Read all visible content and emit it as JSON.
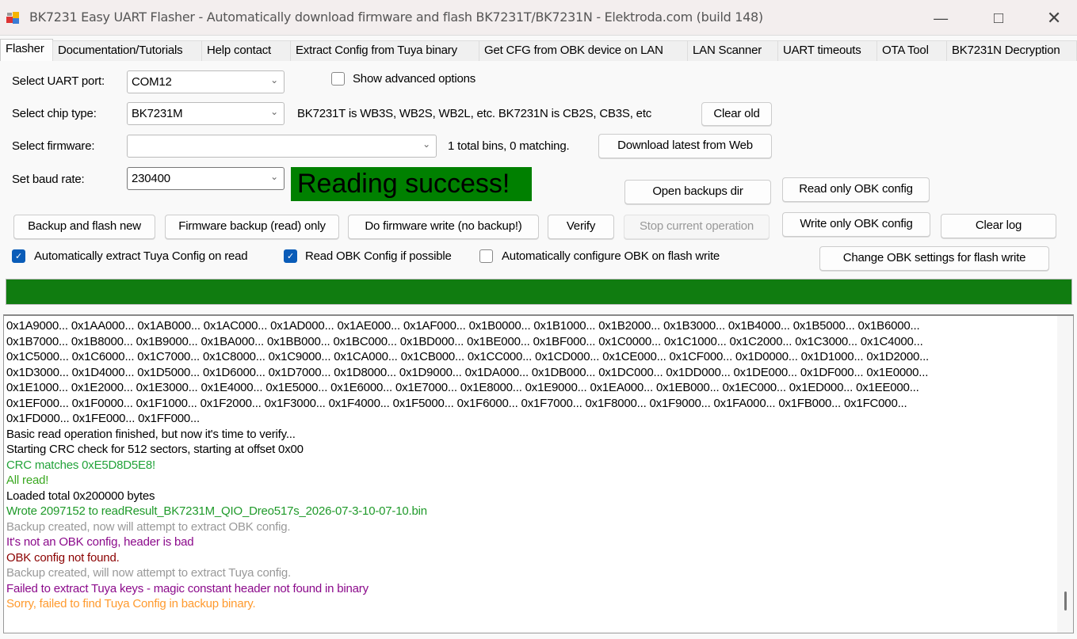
{
  "window": {
    "title": "BK7231 Easy UART Flasher - Automatically download firmware and flash BK7231T/BK7231N  - Elektroda.com (build 148)"
  },
  "tabs": [
    "Flasher",
    "Documentation/Tutorials",
    "Help contact",
    "Extract Config from Tuya binary",
    "Get CFG from OBK device on LAN",
    "LAN Scanner",
    "UART timeouts",
    "OTA Tool",
    "BK7231N Decryption"
  ],
  "form": {
    "uart_label": "Select UART port:",
    "uart_value": "COM12",
    "show_advanced": "Show advanced options",
    "chip_label": "Select chip type:",
    "chip_value": "BK7231M",
    "chip_hint": "BK7231T is WB3S, WB2S, WB2L, etc. BK7231N is CB2S, CB3S, etc",
    "clear_old": "Clear old",
    "firmware_label": "Select firmware:",
    "firmware_value": "",
    "bins_info": "1 total bins, 0 matching.",
    "download_latest": "Download latest from Web",
    "baud_label": "Set baud rate:",
    "baud_value": "230400",
    "status": "Reading success!",
    "status_color": "#008000"
  },
  "buttons": {
    "open_backups": "Open backups dir",
    "read_obk": "Read only OBK config",
    "backup_flash": "Backup and flash new",
    "firmware_backup": "Firmware backup (read) only",
    "do_write": "Do firmware write (no backup!)",
    "verify": "Verify",
    "stop": "Stop current operation",
    "write_obk": "Write only OBK config",
    "clear_log": "Clear log",
    "change_obk": "Change OBK settings for flash write"
  },
  "checkboxes": [
    {
      "label": "Automatically extract Tuya Config on read",
      "checked": true
    },
    {
      "label": "Read OBK Config if possible",
      "checked": true
    },
    {
      "label": "Automatically configure OBK on flash write",
      "checked": false
    }
  ],
  "progress": {
    "percent": 100,
    "color": "#107c10"
  },
  "log": [
    {
      "text": "0x1A9000... 0x1AA000... 0x1AB000... 0x1AC000... 0x1AD000... 0x1AE000... 0x1AF000... 0x1B0000... 0x1B1000... 0x1B2000... 0x1B3000... 0x1B4000... 0x1B5000... 0x1B6000...",
      "color": "#000000"
    },
    {
      "text": "0x1B7000... 0x1B8000... 0x1B9000... 0x1BA000... 0x1BB000... 0x1BC000... 0x1BD000... 0x1BE000... 0x1BF000... 0x1C0000... 0x1C1000... 0x1C2000... 0x1C3000... 0x1C4000...",
      "color": "#000000"
    },
    {
      "text": "0x1C5000... 0x1C6000... 0x1C7000... 0x1C8000... 0x1C9000... 0x1CA000... 0x1CB000... 0x1CC000... 0x1CD000... 0x1CE000... 0x1CF000... 0x1D0000... 0x1D1000... 0x1D2000...",
      "color": "#000000"
    },
    {
      "text": "0x1D3000... 0x1D4000... 0x1D5000... 0x1D6000... 0x1D7000... 0x1D8000... 0x1D9000... 0x1DA000... 0x1DB000... 0x1DC000... 0x1DD000... 0x1DE000... 0x1DF000... 0x1E0000...",
      "color": "#000000"
    },
    {
      "text": "0x1E1000... 0x1E2000... 0x1E3000... 0x1E4000... 0x1E5000... 0x1E6000... 0x1E7000... 0x1E8000... 0x1E9000... 0x1EA000... 0x1EB000... 0x1EC000... 0x1ED000... 0x1EE000...",
      "color": "#000000"
    },
    {
      "text": "0x1EF000... 0x1F0000... 0x1F1000... 0x1F2000... 0x1F3000... 0x1F4000... 0x1F5000... 0x1F6000... 0x1F7000... 0x1F8000... 0x1F9000... 0x1FA000... 0x1FB000... 0x1FC000...",
      "color": "#000000"
    },
    {
      "text": "0x1FD000... 0x1FE000... 0x1FF000...",
      "color": "#000000"
    },
    {
      "text": "Basic read operation finished, but now it's time to verify...",
      "color": "#000000"
    },
    {
      "text": "Starting CRC check for 512 sectors, starting at offset 0x00",
      "color": "#000000"
    },
    {
      "text": "CRC matches 0xE5D8D5E8!",
      "color": "#22a33a"
    },
    {
      "text": "All read!",
      "color": "#3aa820"
    },
    {
      "text": "Loaded total 0x200000 bytes",
      "color": "#000000"
    },
    {
      "text": "Wrote 2097152 to readResult_BK7231M_QIO_Dreo517s_2026-07-3-10-07-10.bin",
      "color": "#1f9a2a"
    },
    {
      "text": "Backup created, now will attempt to extract OBK config.",
      "color": "#999999"
    },
    {
      "text": "It's not an OBK config, header is bad",
      "color": "#8b0a8b"
    },
    {
      "text": "OBK config not found.",
      "color": "#8b0000"
    },
    {
      "text": "Backup created, will now attempt to extract Tuya config.",
      "color": "#999999"
    },
    {
      "text": "Failed to extract Tuya keys - magic constant header not found in binary",
      "color": "#8b0a8b"
    },
    {
      "text": "Sorry, failed to find Tuya Config in backup binary.",
      "color": "#ff9a2e"
    }
  ]
}
